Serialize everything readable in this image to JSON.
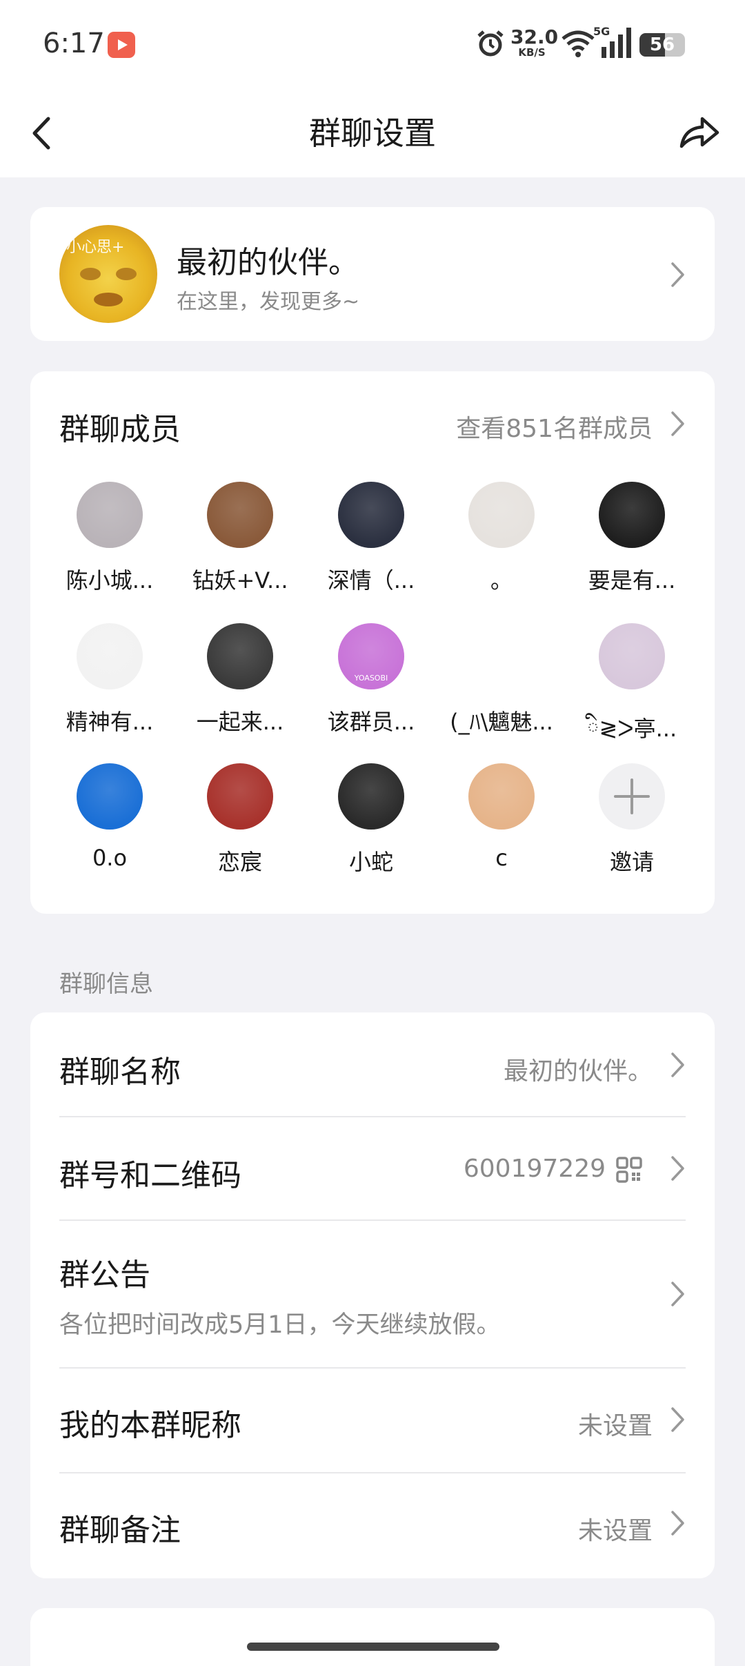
{
  "status_bar": {
    "time": "6:17",
    "net_speed_value": "32.0",
    "net_speed_unit": "KB/S",
    "network": "5G",
    "battery_percent": 56,
    "battery_label": "56"
  },
  "nav": {
    "title": "群聊设置"
  },
  "group": {
    "name": "最初的伙伴。",
    "subtitle": "在这里，发现更多~",
    "avatar_caption": "小心思+"
  },
  "members": {
    "title": "群聊成员",
    "view_all": "查看851名群成员",
    "items": [
      {
        "name": "陈小城...",
        "avatar_color": "#b9b3b8"
      },
      {
        "name": "钻妖+V...",
        "avatar_color": "#8a5a3a"
      },
      {
        "name": "深情（...",
        "avatar_color": "#2b3040"
      },
      {
        "name": "。",
        "avatar_color": "#e6e2de"
      },
      {
        "name": "要是有...",
        "avatar_color": "#1e1e1e"
      },
      {
        "name": "精神有...",
        "avatar_color": "#f2f2f2"
      },
      {
        "name": "一起来...",
        "avatar_color": "#3a3a3a"
      },
      {
        "name": "该群员...",
        "avatar_color": "#c873d8",
        "avatar_text": "YOASOBI"
      },
      {
        "name": "(_ﾊ\\魑魅...",
        "avatar_color": "#ffffff"
      },
      {
        "name": "ི≷ᐳ亭...",
        "avatar_color": "#d8c8dc"
      },
      {
        "name": "0.o",
        "avatar_color": "#1a6fd6"
      },
      {
        "name": "恋宸",
        "avatar_color": "#a8322c"
      },
      {
        "name": "小蛇",
        "avatar_color": "#2a2a2a"
      },
      {
        "name": "c",
        "avatar_color": "#e6b48a"
      },
      {
        "name": "邀请",
        "invite": true
      }
    ]
  },
  "info_section": {
    "label": "群聊信息",
    "rows": {
      "name": {
        "label": "群聊名称",
        "value": "最初的伙伴。"
      },
      "id": {
        "label": "群号和二维码",
        "value": "600197229"
      },
      "notice": {
        "label": "群公告",
        "value": "各位把时间改成5月1日，今天继续放假。"
      },
      "nickname": {
        "label": "我的本群昵称",
        "value": "未设置"
      },
      "remark": {
        "label": "群聊备注",
        "value": "未设置"
      }
    }
  },
  "icons": {
    "back": "chevron-left-icon",
    "share": "share-arrow-icon",
    "qr": "qr-code-icon",
    "row_arrow": "chevron-right-icon",
    "invite": "plus-icon"
  },
  "colors": {
    "background": "#f2f2f6",
    "card": "#ffffff",
    "primary_text": "#1a1a1a",
    "secondary_text": "#8a8a8a",
    "divider": "#e8e8ea"
  }
}
